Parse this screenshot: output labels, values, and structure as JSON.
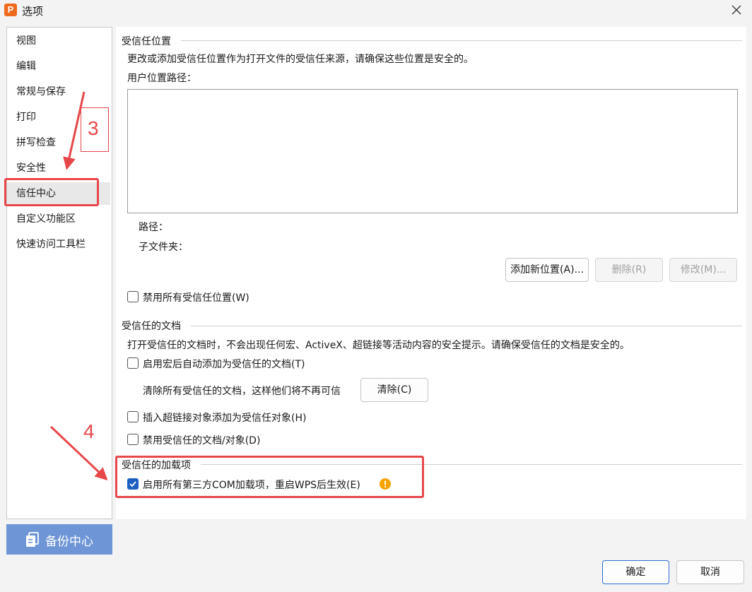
{
  "window": {
    "title": "选项",
    "app_icon": "P"
  },
  "sidebar": {
    "items": [
      {
        "label": "视图"
      },
      {
        "label": "编辑"
      },
      {
        "label": "常规与保存"
      },
      {
        "label": "打印"
      },
      {
        "label": "拼写检查"
      },
      {
        "label": "安全性"
      },
      {
        "label": "信任中心",
        "active": true
      },
      {
        "label": "自定义功能区"
      },
      {
        "label": "快速访问工具栏"
      }
    ],
    "backup_label": "备份中心"
  },
  "trusted_locations": {
    "title": "受信任位置",
    "description": "更改或添加受信任位置作为打开文件的受信任来源，请确保这些位置是安全的。",
    "user_path_label": "用户位置路径：",
    "path_label": "路径：",
    "subfolder_label": "子文件夹：",
    "add_button": "添加新位置(A)...",
    "delete_button": "删除(R)",
    "modify_button": "修改(M)...",
    "disable_all_label": "禁用所有受信任位置(W)",
    "disable_all_checked": false
  },
  "trusted_documents": {
    "title": "受信任的文档",
    "description": "打开受信任的文档时，不会出现任何宏、ActiveX、超链接等活动内容的安全提示。请确保受信任的文档是安全的。",
    "auto_add_label": "启用宏后自动添加为受信任的文档(T)",
    "clear_text": "清除所有受信任的文档，这样他们将不再可信",
    "clear_button": "清除(C)",
    "hyperlink_label": "插入超链接对象添加为受信任对象(H)",
    "disable_label": "禁用受信任的文档/对象(D)"
  },
  "trusted_addins": {
    "title": "受信任的加载项",
    "enable_com_label": "启用所有第三方COM加载项，重启WPS后生效(E)",
    "enable_com_checked": true
  },
  "footer": {
    "ok_button": "确定",
    "cancel_button": "取消"
  },
  "annotations": {
    "step3": "3",
    "step4": "4",
    "color": "#e8474a"
  },
  "colors": {
    "accent": "#1d5fc0",
    "backup_bg": "#6e95d6",
    "warning": "#f5a300"
  },
  "icons": {
    "close": "close-icon",
    "backup": "document-copy-icon",
    "warning": "warning-icon",
    "check": "checkmark-icon"
  }
}
